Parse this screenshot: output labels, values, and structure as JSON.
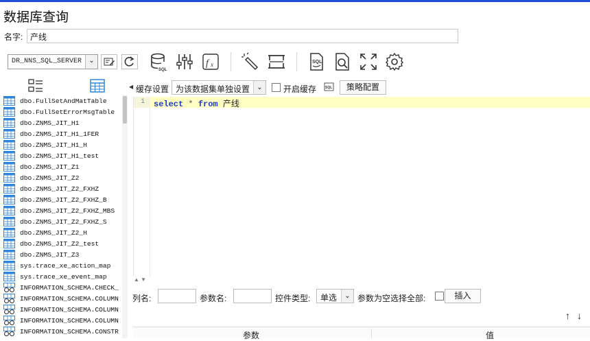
{
  "window": {
    "title": "数据库查询"
  },
  "name_field": {
    "label": "名字:",
    "value": "产线"
  },
  "toolbar": {
    "datasource_selected": "DR_NNS_SQL_SERVER",
    "icons": [
      "edit-datasource-icon",
      "refresh-icon",
      "database-sql-icon",
      "sliders-icon",
      "formula-icon",
      "magic-wand-icon",
      "column-resize-icon",
      "sql-file-icon",
      "preview-search-icon",
      "expand-icon",
      "settings-gear-icon"
    ]
  },
  "left_panel": {
    "tabs": [
      "list-view-icon",
      "table-view-icon"
    ],
    "items": [
      {
        "label": "dbo.FullSetAndMatTable",
        "kind": "table"
      },
      {
        "label": "dbo.FullSetErrorMsgTable",
        "kind": "table"
      },
      {
        "label": "dbo.ZNMS_JIT_H1",
        "kind": "table"
      },
      {
        "label": "dbo.ZNMS_JIT_H1_1FER",
        "kind": "table"
      },
      {
        "label": "dbo.ZNMS_JIT_H1_H",
        "kind": "table"
      },
      {
        "label": "dbo.ZNMS_JIT_H1_test",
        "kind": "table"
      },
      {
        "label": "dbo.ZNMS_JIT_Z1",
        "kind": "table"
      },
      {
        "label": "dbo.ZNMS_JIT_Z2",
        "kind": "table"
      },
      {
        "label": "dbo.ZNMS_JIT_Z2_FXHZ",
        "kind": "table"
      },
      {
        "label": "dbo.ZNMS_JIT_Z2_FXHZ_B",
        "kind": "table"
      },
      {
        "label": "dbo.ZNMS_JIT_Z2_FXHZ_MBS",
        "kind": "table"
      },
      {
        "label": "dbo.ZNMS_JIT_Z2_FXHZ_S",
        "kind": "table"
      },
      {
        "label": "dbo.ZNMS_JIT_Z2_H",
        "kind": "table"
      },
      {
        "label": "dbo.ZNMS_JIT_Z2_test",
        "kind": "table"
      },
      {
        "label": "dbo.ZNMS_JIT_Z3",
        "kind": "table"
      },
      {
        "label": "sys.trace_xe_action_map",
        "kind": "table"
      },
      {
        "label": "sys.trace_xe_event_map",
        "kind": "table"
      },
      {
        "label": "INFORMATION_SCHEMA.CHECK_",
        "kind": "view"
      },
      {
        "label": "INFORMATION_SCHEMA.COLUMN",
        "kind": "view"
      },
      {
        "label": "INFORMATION_SCHEMA.COLUMN",
        "kind": "view"
      },
      {
        "label": "INFORMATION_SCHEMA.COLUMN",
        "kind": "view"
      },
      {
        "label": "INFORMATION_SCHEMA.CONSTR",
        "kind": "view"
      }
    ]
  },
  "cache": {
    "label": "缓存设置",
    "select_value": "为该数据集单独设置",
    "enable_label": "开启缓存",
    "strategy_button": "策略配置"
  },
  "editor": {
    "line_number": "1",
    "kw_select": "select",
    "star": "*",
    "kw_from": "from",
    "table": "产线"
  },
  "params": {
    "column_label": "列名:",
    "param_label": "参数名:",
    "control_type_label": "控件类型:",
    "control_type_value": "单选",
    "empty_select_all_label": "参数为空选择全部:",
    "insert_button": "插入"
  },
  "table": {
    "headers": [
      "参数",
      "值"
    ]
  }
}
